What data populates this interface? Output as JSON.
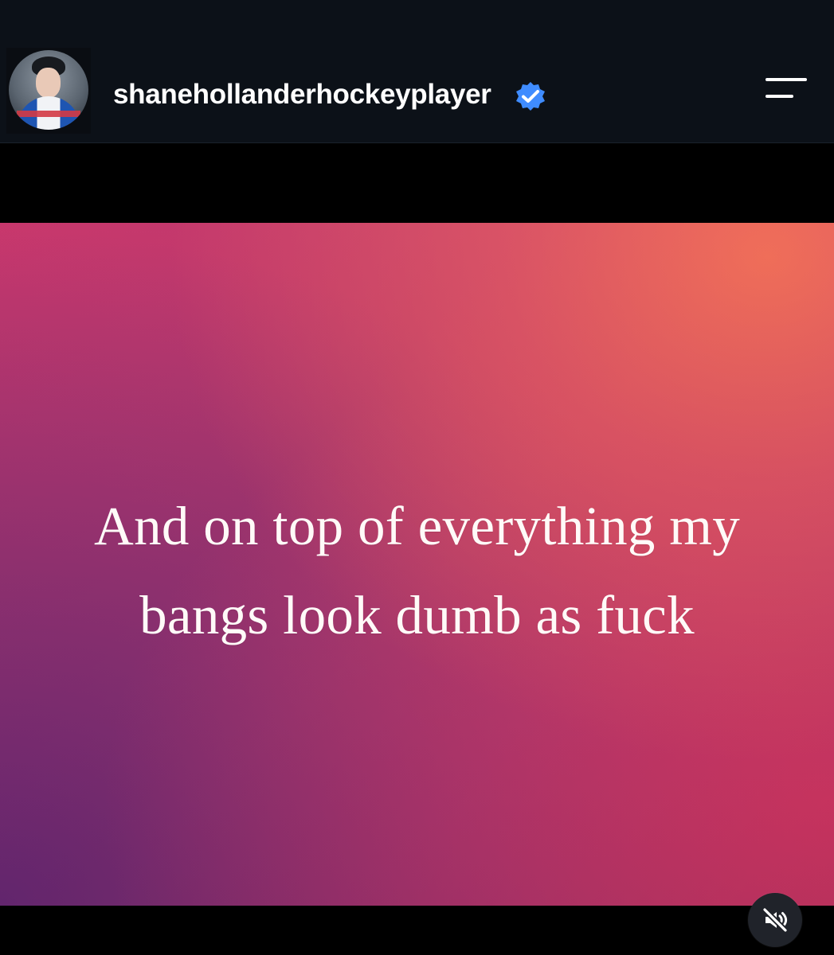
{
  "header": {
    "username": "shanehollanderhockeyplayer",
    "avatar_icon": "profile-photo",
    "verified_icon": "verified-badge-icon",
    "menu_icon": "hamburger-menu-icon"
  },
  "story": {
    "lines": [
      "And on top of everything my",
      "bangs look dumb as fuck"
    ],
    "background_colors": {
      "top_right": "#f26c53",
      "center": "#c63168",
      "bottom_left": "#652777",
      "right_edge": "#dd3665"
    }
  },
  "controls": {
    "mute_icon": "muted-speaker-icon"
  },
  "colors": {
    "header_background": "#0c1118",
    "page_background": "#05070a",
    "verified_blue": "#3f8cff",
    "text": "#ffffff"
  }
}
